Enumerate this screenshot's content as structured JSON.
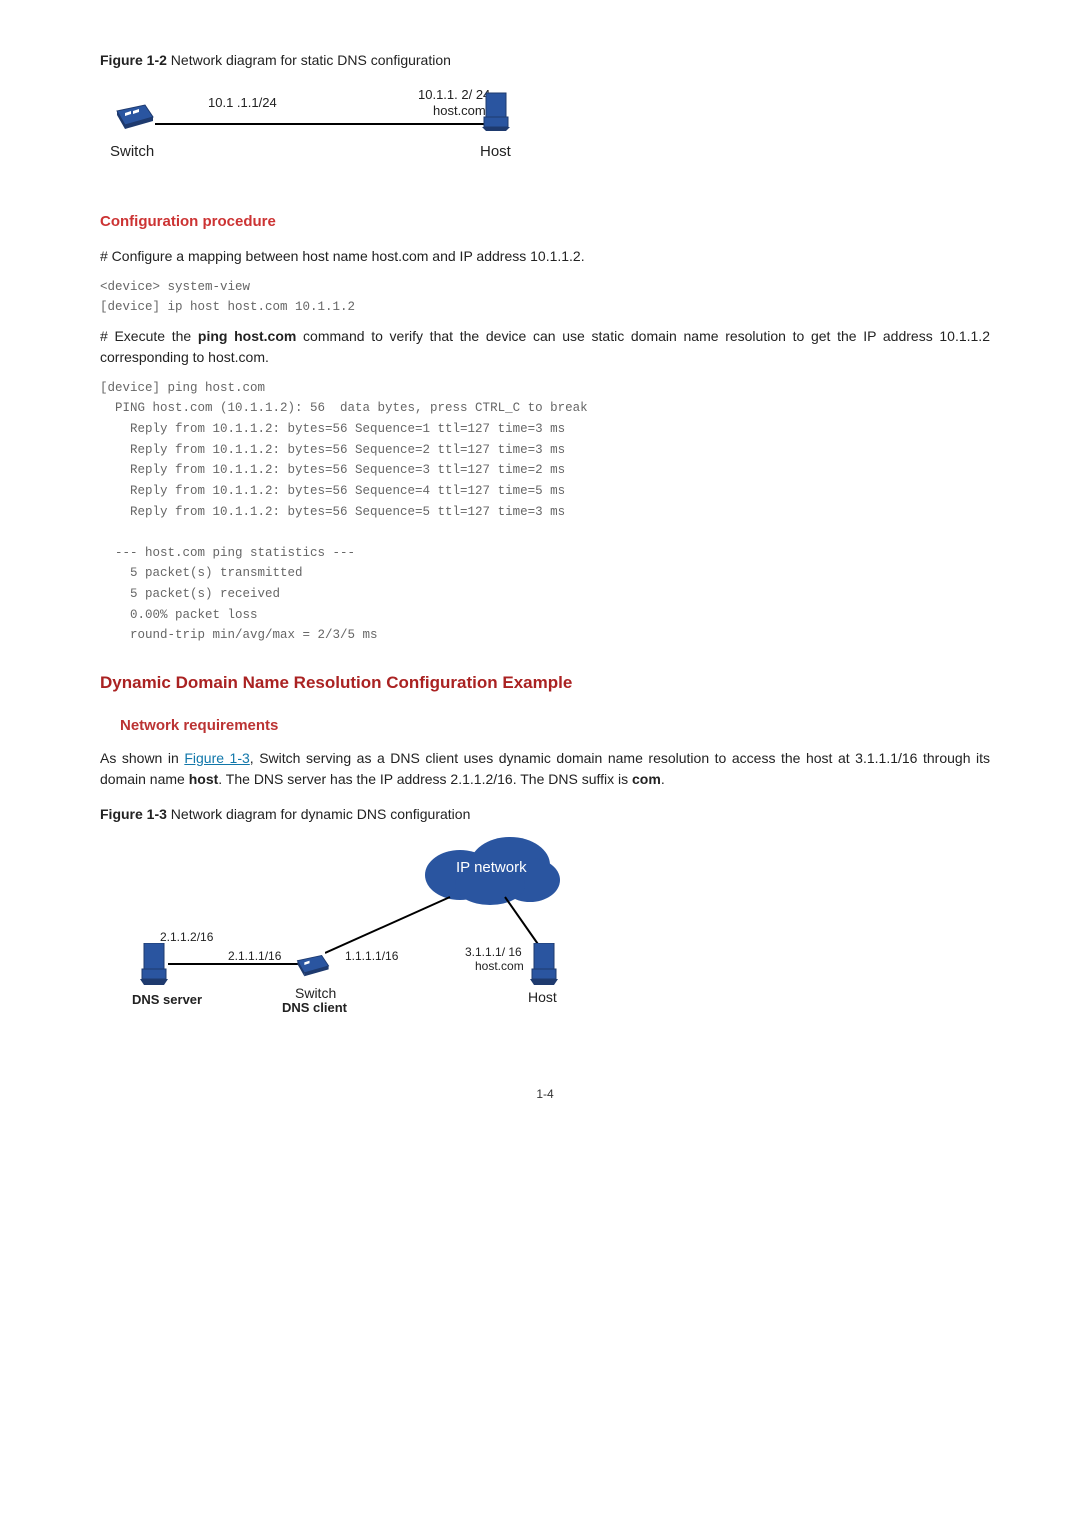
{
  "fig1": {
    "label_prefix": "Figure 1-2",
    "label_text": " Network diagram for static DNS configuration",
    "ip_left": "10.1 .1.1/24",
    "ip_right_top": "10.1.1. 2/ 24",
    "ip_right_host": "host.com",
    "left_device": "Switch",
    "right_device": "Host"
  },
  "section1": {
    "title": "Configuration procedure",
    "para1": "# Configure a mapping between host name host.com and IP address 10.1.1.2.",
    "code1": "<device> system-view\n[device] ip host host.com 10.1.1.2",
    "para2_a": "# Execute the ",
    "para2_cmd": "ping host.com",
    "para2_b": " command to verify that the device can use static domain name resolution to get the IP address 10.1.1.2 corresponding to host.com.",
    "code2": "[device] ping host.com\n  PING host.com (10.1.1.2): 56  data bytes, press CTRL_C to break\n    Reply from 10.1.1.2: bytes=56 Sequence=1 ttl=127 time=3 ms\n    Reply from 10.1.1.2: bytes=56 Sequence=2 ttl=127 time=3 ms\n    Reply from 10.1.1.2: bytes=56 Sequence=3 ttl=127 time=2 ms\n    Reply from 10.1.1.2: bytes=56 Sequence=4 ttl=127 time=5 ms\n    Reply from 10.1.1.2: bytes=56 Sequence=5 ttl=127 time=3 ms\n\n  --- host.com ping statistics ---\n    5 packet(s) transmitted\n    5 packet(s) received\n    0.00% packet loss\n    round-trip min/avg/max = 2/3/5 ms"
  },
  "section2": {
    "title": "Dynamic Domain Name Resolution Configuration Example",
    "sub1": "Network requirements",
    "para_a": "As shown in ",
    "link": "Figure 1-3",
    "para_b": ", Switch serving as a DNS client uses dynamic domain name resolution to access the host at 3.1.1.1/16 through its domain name ",
    "host": "host",
    "para_c": ". The DNS server has the IP address 2.1.1.2/16. The DNS suffix is ",
    "com": "com",
    "para_d": "."
  },
  "fig2": {
    "label_prefix": "Figure 1-3",
    "label_text": " Network diagram for dynamic DNS configuration",
    "cloud": "IP network",
    "ip_dns": "2.1.1.2/16",
    "ip_sw_left": "2.1.1.1/16",
    "ip_sw_right": "1.1.1.1/16",
    "ip_host": "3.1.1.1/ 16",
    "hostcom": "host.com",
    "dns_label": "DNS server",
    "switch_label": "Switch",
    "client_label": "DNS client",
    "host_label": "Host"
  },
  "page_num": "1-4"
}
